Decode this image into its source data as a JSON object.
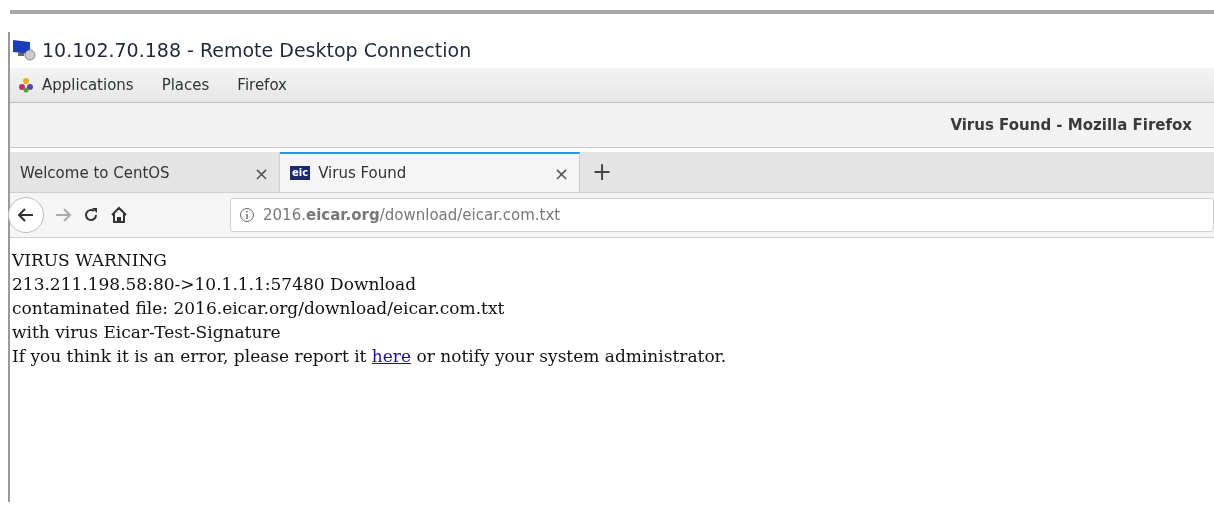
{
  "rdp_window": {
    "title": "10.102.70.188 - Remote Desktop Connection"
  },
  "top_bar": {
    "menus": [
      "Applications",
      "Places",
      "Firefox"
    ]
  },
  "browser": {
    "title": "Virus Found - Mozilla Firefox",
    "tabs": [
      {
        "label": "Welcome to CentOS",
        "close": "×",
        "selected": false
      },
      {
        "label": "Virus Found",
        "close": "×",
        "selected": true,
        "favicon": "eic"
      }
    ],
    "new_tab": "+",
    "address": {
      "url": "2016.**eicar.org**/download/eicar.com.txt"
    }
  },
  "page": {
    "lines": [
      "VIRUS WARNING",
      "213.211.198.58:80->10.1.1.1:57480 Download",
      "contaminated file: 2016.eicar.org/download/eicar.com.txt",
      "with virus Eicar-Test-Signature"
    ],
    "report": {
      "before": "If you think it is an error, please report it ",
      "link": "here",
      "after": " or notify your system administrator."
    }
  }
}
